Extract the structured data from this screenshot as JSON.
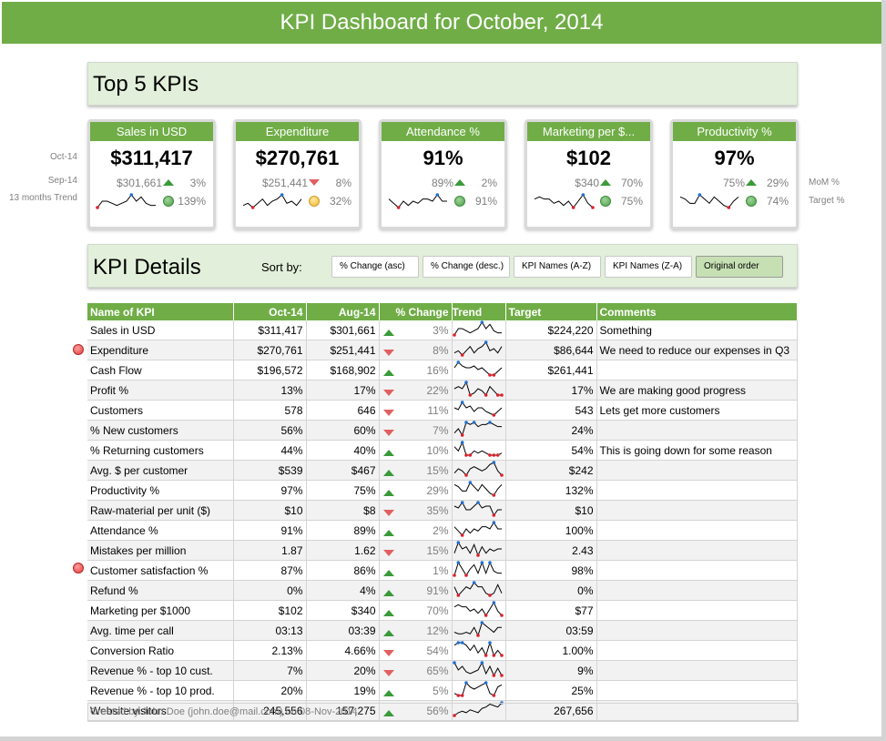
{
  "title": "KPI Dashboard for October, 2014",
  "top5": {
    "heading": "Top 5 KPIs",
    "side_labels": {
      "current": "Oct-14",
      "previous": "Sep-14",
      "trend": "13 months Trend"
    },
    "right_labels": {
      "mom": "MoM %",
      "target": "Target %"
    },
    "cards": [
      {
        "name": "Sales in USD",
        "value": "$311,417",
        "previous": "$301,661",
        "direction": "up",
        "mom": "3%",
        "status": "green",
        "target_pct": "139%",
        "trend": [
          2,
          5,
          5,
          4,
          3,
          4,
          5,
          8,
          5,
          7,
          4,
          3,
          3
        ],
        "min_index": 0,
        "max_index": 7
      },
      {
        "name": "Expenditure",
        "value": "$270,761",
        "previous": "$251,441",
        "direction": "down",
        "mom": "8%",
        "status": "amber",
        "target_pct": "32%",
        "trend": [
          3,
          4,
          2,
          4,
          6,
          3,
          5,
          6,
          8,
          4,
          5,
          3,
          6
        ],
        "min_index": 2,
        "max_index": 8
      },
      {
        "name": "Attendance %",
        "value": "91%",
        "previous": "89%",
        "direction": "up",
        "mom": "2%",
        "status": "green",
        "target_pct": "91%",
        "trend": [
          6,
          4,
          2,
          5,
          3,
          5,
          4,
          6,
          6,
          5,
          8,
          5,
          5
        ],
        "min_index": 2,
        "max_index": 10
      },
      {
        "name": "Marketing per $...",
        "value": "$102",
        "previous": "$340",
        "direction": "up",
        "mom": "70%",
        "status": "green",
        "target_pct": "75%",
        "trend": [
          5,
          6,
          5,
          5,
          3,
          4,
          2,
          4,
          1,
          4,
          7,
          3,
          1
        ],
        "min_index": 12,
        "max_index": 10
      },
      {
        "name": "Productivity %",
        "value": "97%",
        "previous": "75%",
        "direction": "up",
        "mom": "29%",
        "status": "green",
        "target_pct": "74%",
        "trend": [
          6,
          5,
          3,
          3,
          7,
          5,
          3,
          6,
          4,
          2,
          1,
          4,
          6
        ],
        "min_index": 10,
        "max_index": 4
      }
    ]
  },
  "details": {
    "heading": "KPI Details",
    "sort_label": "Sort by:",
    "sort_buttons": [
      "% Change (asc)",
      "% Change (desc.)",
      "KPI Names (A-Z)",
      "KPI Names (Z-A)",
      "Original order"
    ],
    "active_sort": 4,
    "columns": [
      "Name of KPI",
      "Oct-14",
      "Aug-14",
      "% Change",
      "Trend",
      "Target",
      "Comments"
    ],
    "rows": [
      {
        "name": "Sales in USD",
        "oct": "$311,417",
        "aug": "$301,661",
        "dir": "up",
        "chg": "3%",
        "target": "$224,220",
        "comment": "Something",
        "flag": false,
        "trend": [
          2,
          5,
          5,
          4,
          3,
          4,
          5,
          8,
          5,
          7,
          4,
          3,
          3
        ]
      },
      {
        "name": "Expenditure",
        "oct": "$270,761",
        "aug": "$251,441",
        "dir": "down",
        "chg": "8%",
        "target": "$86,644",
        "comment": "We need to reduce our expenses in Q3",
        "flag": true,
        "trend": [
          3,
          4,
          2,
          4,
          6,
          3,
          5,
          6,
          8,
          4,
          5,
          3,
          6
        ]
      },
      {
        "name": "Cash Flow",
        "oct": "$196,572",
        "aug": "$168,902",
        "dir": "up",
        "chg": "16%",
        "target": "$261,441",
        "comment": "",
        "flag": false,
        "trend": [
          5,
          8,
          6,
          5,
          5,
          6,
          4,
          5,
          3,
          1,
          1,
          3,
          5
        ]
      },
      {
        "name": "Profit %",
        "oct": "13%",
        "aug": "17%",
        "dir": "down",
        "chg": "22%",
        "target": "17%",
        "comment": "We are making good progress",
        "flag": false,
        "trend": [
          5,
          6,
          5,
          8,
          2,
          3,
          5,
          4,
          2,
          6,
          4,
          2,
          2
        ]
      },
      {
        "name": "Customers",
        "oct": "578",
        "aug": "646",
        "dir": "down",
        "chg": "11%",
        "target": "543",
        "comment": "Lets get more customers",
        "flag": false,
        "trend": [
          5,
          4,
          8,
          5,
          6,
          3,
          5,
          5,
          3,
          2,
          1,
          3,
          5
        ]
      },
      {
        "name": "% New customers",
        "oct": "56%",
        "aug": "60%",
        "dir": "down",
        "chg": "7%",
        "target": "24%",
        "comment": "",
        "flag": false,
        "trend": [
          2,
          4,
          1,
          7,
          6,
          7,
          5,
          6,
          6,
          7,
          6,
          5,
          5
        ]
      },
      {
        "name": "% Returning customers",
        "oct": "44%",
        "aug": "40%",
        "dir": "up",
        "chg": "10%",
        "target": "54%",
        "comment": "This is going down for some reason",
        "flag": false,
        "trend": [
          6,
          4,
          8,
          2,
          2,
          4,
          3,
          4,
          3,
          2,
          2,
          2,
          3
        ]
      },
      {
        "name": "Avg. $ per customer",
        "oct": "$539",
        "aug": "$467",
        "dir": "up",
        "chg": "15%",
        "target": "$242",
        "comment": "",
        "flag": false,
        "trend": [
          3,
          5,
          4,
          2,
          5,
          6,
          5,
          4,
          5,
          7,
          8,
          4,
          2
        ]
      },
      {
        "name": "Productivity %",
        "oct": "97%",
        "aug": "75%",
        "dir": "up",
        "chg": "29%",
        "target": "132%",
        "comment": "",
        "flag": false,
        "trend": [
          6,
          5,
          3,
          3,
          7,
          5,
          3,
          6,
          4,
          2,
          1,
          4,
          6
        ]
      },
      {
        "name": "Raw-material per unit ($)",
        "oct": "$10",
        "aug": "$8",
        "dir": "down",
        "chg": "35%",
        "target": "$10",
        "comment": "",
        "flag": false,
        "trend": [
          6,
          5,
          8,
          4,
          4,
          6,
          8,
          5,
          6,
          6,
          1,
          4,
          4
        ]
      },
      {
        "name": "Attendance %",
        "oct": "91%",
        "aug": "89%",
        "dir": "up",
        "chg": "2%",
        "target": "100%",
        "comment": "",
        "flag": false,
        "trend": [
          6,
          4,
          2,
          5,
          3,
          5,
          4,
          6,
          6,
          5,
          8,
          5,
          5
        ]
      },
      {
        "name": "Mistakes per million",
        "oct": "1.87",
        "aug": "1.62",
        "dir": "down",
        "chg": "15%",
        "target": "2.43",
        "comment": "",
        "flag": false,
        "trend": [
          3,
          8,
          5,
          6,
          3,
          7,
          2,
          6,
          3,
          5,
          4,
          5,
          5
        ]
      },
      {
        "name": "Customer satisfaction %",
        "oct": "87%",
        "aug": "86%",
        "dir": "up",
        "chg": "1%",
        "target": "98%",
        "comment": "",
        "flag": false,
        "trend": [
          2,
          8,
          5,
          2,
          5,
          7,
          3,
          8,
          3,
          8,
          4,
          3,
          3
        ]
      },
      {
        "name": "Refund %",
        "oct": "0%",
        "aug": "4%",
        "dir": "up",
        "chg": "91%",
        "target": "0%",
        "comment": "",
        "flag": true,
        "trend": [
          5,
          1,
          3,
          5,
          4,
          7,
          5,
          5,
          2,
          1,
          2,
          6,
          2
        ]
      },
      {
        "name": "Marketing per $1000",
        "oct": "$102",
        "aug": "$340",
        "dir": "up",
        "chg": "70%",
        "target": "$77",
        "comment": "",
        "flag": false,
        "trend": [
          5,
          6,
          5,
          5,
          3,
          4,
          2,
          4,
          1,
          4,
          7,
          3,
          1
        ]
      },
      {
        "name": "Avg. time per call",
        "oct": "03:13",
        "aug": "03:39",
        "dir": "up",
        "chg": "12%",
        "target": "03:59",
        "comment": "",
        "flag": false,
        "trend": [
          2,
          1,
          1,
          2,
          1,
          5,
          0,
          8,
          6,
          4,
          2,
          5,
          5
        ]
      },
      {
        "name": "Conversion Ratio",
        "oct": "2.13%",
        "aug": "4.66%",
        "dir": "down",
        "chg": "54%",
        "target": "1.00%",
        "comment": "",
        "flag": false,
        "trend": [
          5,
          6,
          6,
          5,
          3,
          5,
          2,
          4,
          1,
          6,
          1,
          3,
          1
        ]
      },
      {
        "name": "Revenue % - top 10 cust.",
        "oct": "7%",
        "aug": "20%",
        "dir": "down",
        "chg": "65%",
        "target": "9%",
        "comment": "",
        "flag": false,
        "trend": [
          8,
          4,
          6,
          3,
          2,
          3,
          4,
          8,
          2,
          6,
          1,
          5,
          1
        ]
      },
      {
        "name": "Revenue % - top 10 prod.",
        "oct": "20%",
        "aug": "19%",
        "dir": "up",
        "chg": "5%",
        "target": "25%",
        "comment": "",
        "flag": false,
        "trend": [
          2,
          1,
          1,
          7,
          5,
          4,
          5,
          6,
          7,
          2,
          1,
          5,
          6
        ]
      },
      {
        "name": "Website visitors",
        "oct": "245,556",
        "aug": "157,275",
        "dir": "up",
        "chg": "56%",
        "target": "267,656",
        "comment": "",
        "flag": false,
        "trend": [
          0,
          2,
          3,
          2,
          4,
          3,
          2,
          5,
          6,
          8,
          7,
          6,
          9
        ]
      }
    ]
  },
  "footer": "Created by John Doe (john.doe@mail.com) on 08-Nov-2014.",
  "colors": {
    "accent": "#70ad47",
    "section_bg": "#e2efda",
    "up": "#3a9a3a",
    "down": "#e06060",
    "spark_min": "#e0202a",
    "spark_max": "#1f6fd0"
  }
}
